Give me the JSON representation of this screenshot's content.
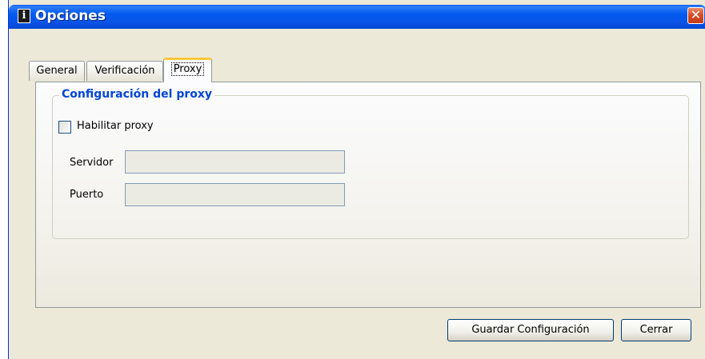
{
  "window": {
    "title": "Opciones",
    "close_glyph": "✕",
    "app_icon_glyph": "i"
  },
  "tabs": [
    {
      "label": "General",
      "active": false
    },
    {
      "label": "Verificación",
      "active": false
    },
    {
      "label": "Proxy",
      "active": true
    }
  ],
  "proxy": {
    "group_title": "Configuración del proxy",
    "enable_label": "Habilitar proxy",
    "enable_checked": false,
    "server_label": "Servidor",
    "server_value": "",
    "port_label": "Puerto",
    "port_value": ""
  },
  "buttons": {
    "save_label": "Guardar Configuración",
    "close_label": "Cerrar"
  },
  "colors": {
    "titlebar": "#0058ee",
    "group_title": "#0046d5",
    "active_tab_accent": "#ffc73d",
    "close_button": "#d34a26"
  }
}
